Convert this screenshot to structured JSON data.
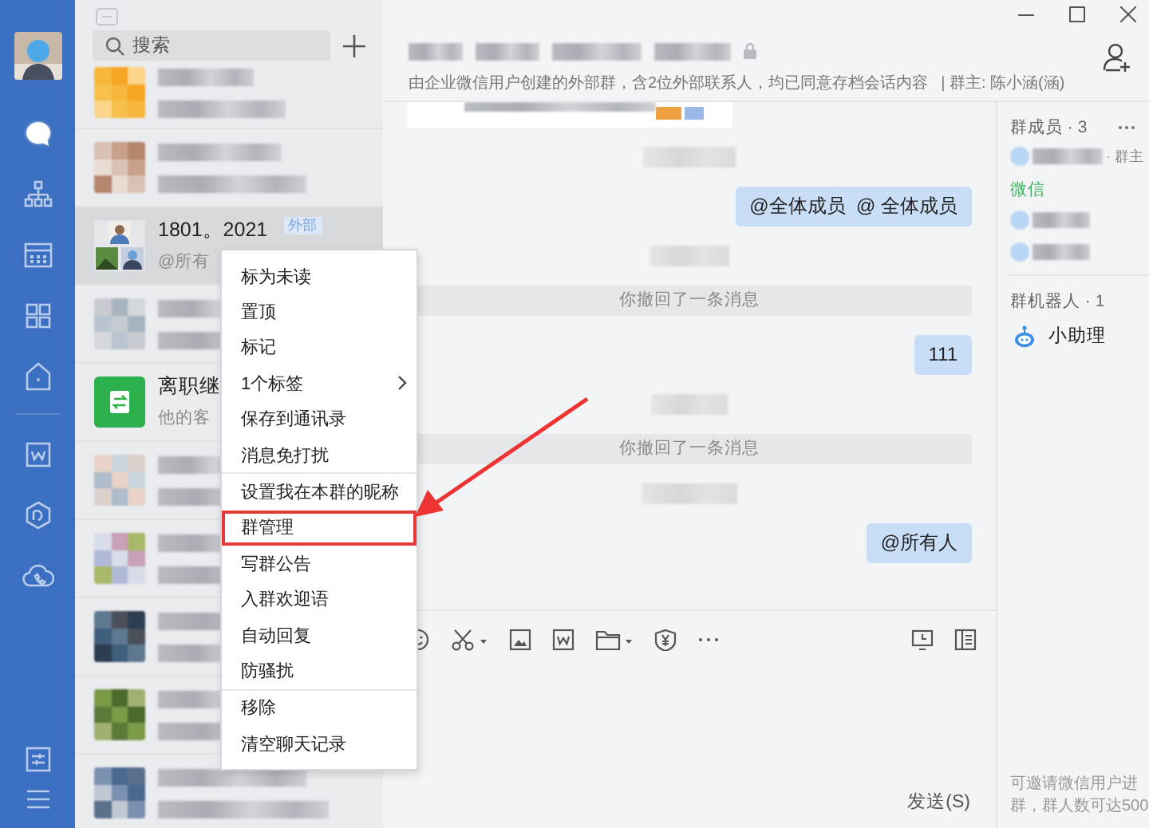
{
  "nav": {
    "main": [
      {
        "kind": "chat",
        "selected": true
      },
      {
        "kind": "contacts",
        "selected": false
      },
      {
        "kind": "calendar",
        "selected": false
      },
      {
        "kind": "apps",
        "selected": false
      },
      {
        "kind": "workbench",
        "selected": false
      }
    ],
    "tools": [
      {
        "kind": "doc"
      },
      {
        "kind": "drive"
      },
      {
        "kind": "meeting"
      }
    ],
    "bottom": [
      {
        "kind": "settings"
      },
      {
        "kind": "menu"
      }
    ]
  },
  "search": {
    "placeholder": "搜索"
  },
  "conversations": [
    {
      "kind": "blurred",
      "selected": false
    },
    {
      "kind": "blurred",
      "selected": false
    },
    {
      "kind": "group",
      "name": "1801。2021",
      "tag": "外部",
      "preview": "@所有",
      "selected": true
    },
    {
      "kind": "blurred",
      "selected": false
    },
    {
      "kind": "handover",
      "name": "离职继",
      "preview": "他的客",
      "selected": false
    },
    {
      "kind": "blurred",
      "selected": false
    },
    {
      "kind": "blurred",
      "selected": false
    },
    {
      "kind": "blurred",
      "selected": false
    },
    {
      "kind": "blurred",
      "selected": false
    },
    {
      "kind": "blurred",
      "selected": false
    }
  ],
  "chat": {
    "subtitle": "由企业微信用户创建的外部群，含2位外部联系人，均已同意存档会话内容",
    "owner": "| 群主: 陈小涵(涵)",
    "messages": [
      {
        "kind": "card"
      },
      {
        "kind": "blurred"
      },
      {
        "kind": "outgoing",
        "text": "@全体成员  @ 全体成员"
      },
      {
        "kind": "blurred"
      },
      {
        "kind": "notice",
        "text": "你撤回了一条消息"
      },
      {
        "kind": "outgoing",
        "text": "111"
      },
      {
        "kind": "blurred"
      },
      {
        "kind": "notice",
        "text": "你撤回了一条消息"
      },
      {
        "kind": "blurred"
      },
      {
        "kind": "outgoing",
        "text": "@所有人"
      }
    ],
    "send_button": "发送(S)"
  },
  "members": {
    "title": "群成员 · 3",
    "owner_tag": "· 群主",
    "wechat_label": "微信",
    "robots_title": "群机器人 · 1",
    "robot": "小助理",
    "footer": "可邀请微信用户进群，群人数可达500"
  },
  "context_menu": {
    "groups": [
      [
        {
          "label": "标为未读",
          "submenu": false,
          "highlighted": false
        },
        {
          "label": "置顶",
          "submenu": false,
          "highlighted": false
        },
        {
          "label": "标记",
          "submenu": false,
          "highlighted": false
        },
        {
          "label": "1个标签",
          "submenu": true,
          "highlighted": false
        },
        {
          "label": "保存到通讯录",
          "submenu": false,
          "highlighted": false
        },
        {
          "label": "消息免打扰",
          "submenu": false,
          "highlighted": false
        }
      ],
      [
        {
          "label": "设置我在本群的昵称",
          "submenu": false,
          "highlighted": false
        },
        {
          "label": "群管理",
          "submenu": false,
          "highlighted": true
        },
        {
          "label": "写群公告",
          "submenu": false,
          "highlighted": false
        },
        {
          "label": "入群欢迎语",
          "submenu": false,
          "highlighted": false
        },
        {
          "label": "自动回复",
          "submenu": false,
          "highlighted": false
        },
        {
          "label": "防骚扰",
          "submenu": false,
          "highlighted": false
        }
      ],
      [
        {
          "label": "移除",
          "submenu": false,
          "highlighted": false
        },
        {
          "label": "清空聊天记录",
          "submenu": false,
          "highlighted": false
        }
      ]
    ]
  }
}
